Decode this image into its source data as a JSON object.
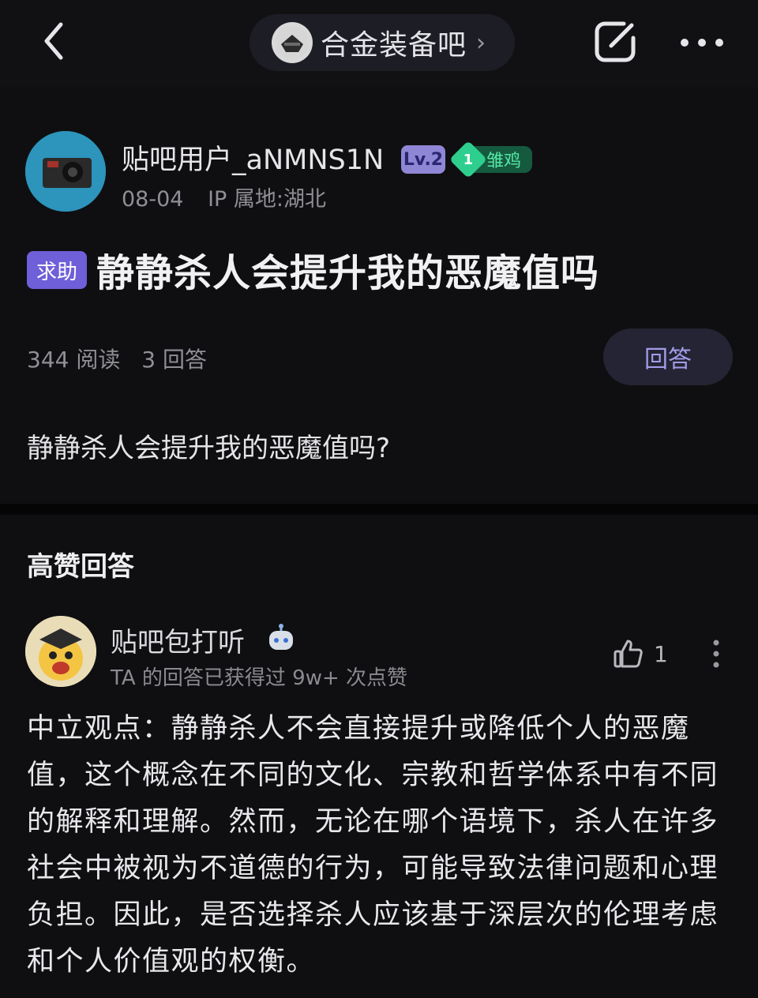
{
  "topbar": {
    "forum_name": "合金装备吧",
    "chevron": "›",
    "icons": {
      "back": "back-arrow-icon",
      "share": "share-icon",
      "more": "more-dots-icon",
      "forum_logo": "forum-logo-icon"
    }
  },
  "author": {
    "name": "贴吧用户_aNMNS1N",
    "level": "Lv.2",
    "rank_number": "1",
    "rank_title": "雏鸡",
    "date": "08-04",
    "ip": "IP 属地:湖北"
  },
  "post": {
    "tag": "求助",
    "title": "静静杀人会提升我的恶魔值吗",
    "reads": "344 阅读",
    "answers": "3 回答",
    "reply_label": "回答",
    "body": "静静杀人会提升我的恶魔值吗?"
  },
  "top_answers": {
    "section_title": "高赞回答",
    "answer": {
      "author": "贴吧包打听",
      "badge_icon": "robot-icon",
      "subtitle": "TA 的回答已获得过 9w+ 次点赞",
      "likes": "1",
      "text": "中立观点：静静杀人不会直接提升或降低个人的恶魔值，这个概念在不同的文化、宗教和哲学体系中有不同的解释和理解。然而，无论在哪个语境下，杀人在许多社会中被视为不道德的行为，可能导致法律问题和心理负担。因此，是否选择杀人应该基于深层次的伦理考虑和个人价值观的权衡。"
    }
  },
  "colors": {
    "background": "#0f0f11",
    "accent_purple": "#6f5fd8",
    "rank_green": "#2ecf8e",
    "muted_text": "#8f8f96"
  }
}
